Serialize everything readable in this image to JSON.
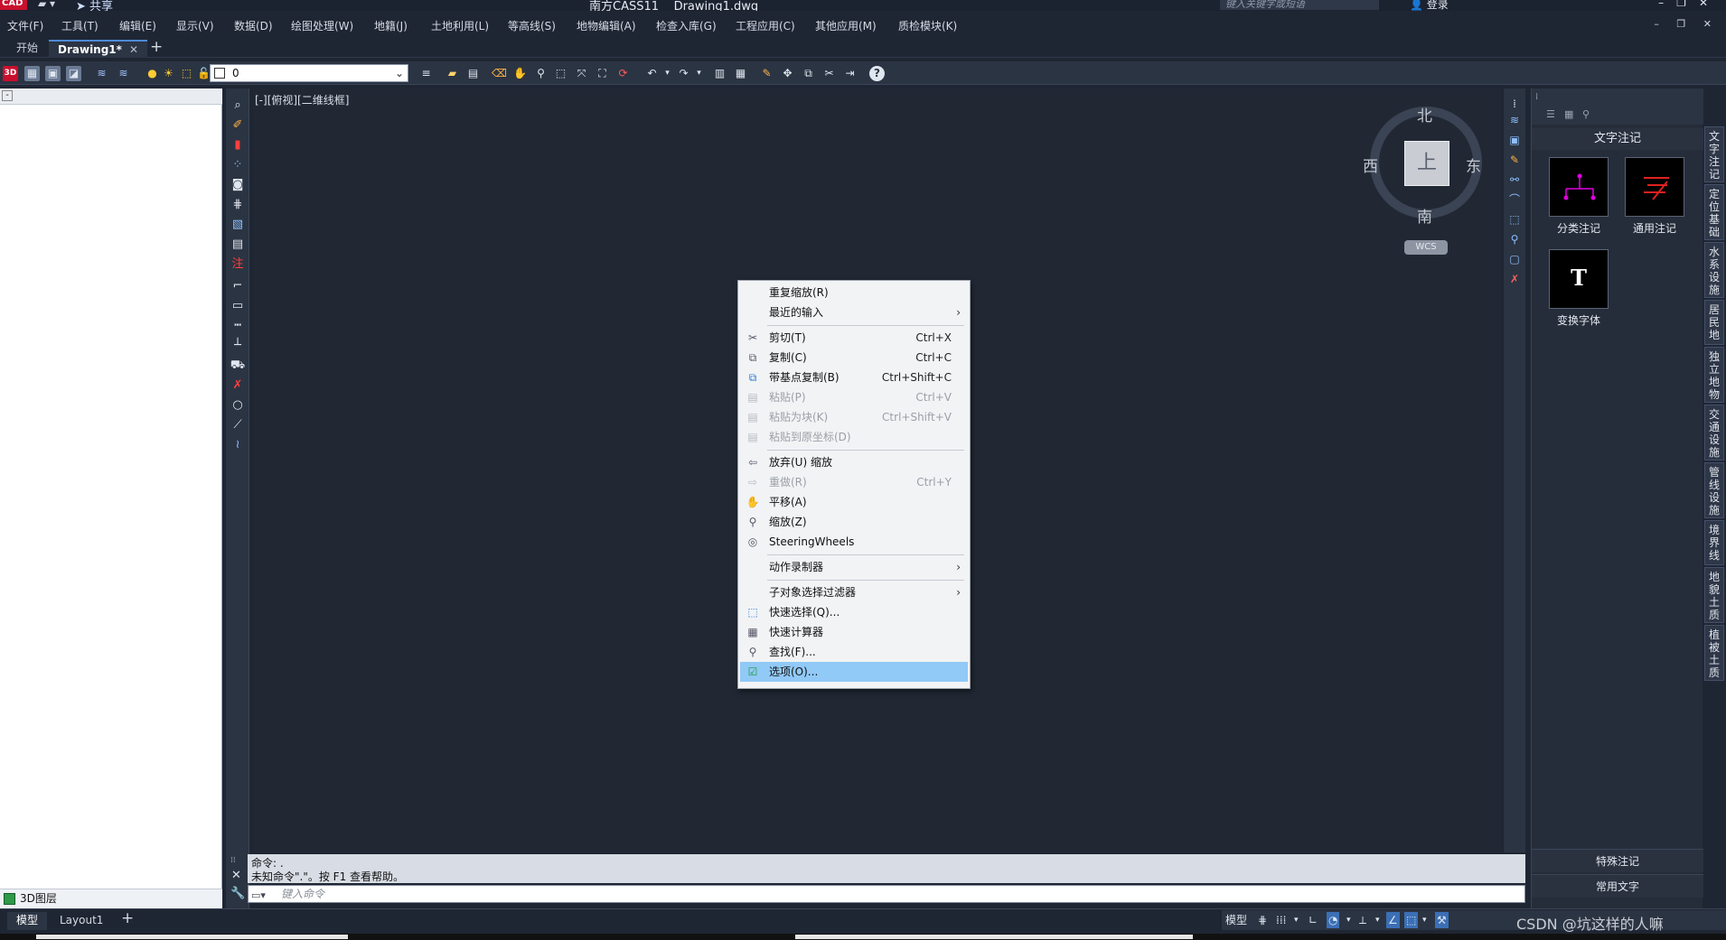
{
  "titlebar": {
    "logo": "CAD",
    "share_label": "共享",
    "app_title": "南方CASS11",
    "doc_title": "Drawing1.dwg",
    "search_placeholder": "键入关键字或短语",
    "login_label": "登录"
  },
  "menu": [
    "文件(F)",
    "工具(T)",
    "编辑(E)",
    "显示(V)",
    "数据(D)",
    "绘图处理(W)",
    "地籍(J)",
    "土地利用(L)",
    "等高线(S)",
    "地物编辑(A)",
    "检查入库(G)",
    "工程应用(C)",
    "其他应用(M)",
    "质检模块(K)"
  ],
  "tabs": {
    "start_label": "开始",
    "active_label": "Drawing1*",
    "close_glyph": "✕",
    "add_glyph": "+"
  },
  "toolbar": {
    "layer_value": "0",
    "help_glyph": "?"
  },
  "left_panel": {
    "minimize_glyph": "-",
    "layer_label": "3D图层"
  },
  "canvas": {
    "view_label": "[-][俯视][二维线框]"
  },
  "viewcube": {
    "north": "北",
    "south": "南",
    "east": "东",
    "west": "西",
    "face": "上",
    "wcs_label": "WCS"
  },
  "context_menu": {
    "items": [
      {
        "label": "重复缩放(R)",
        "shortcut": "",
        "submenu": false,
        "disabled": false,
        "icon": ""
      },
      {
        "label": "最近的输入",
        "shortcut": "",
        "submenu": true,
        "disabled": false,
        "icon": ""
      },
      {
        "label": "剪切(T)",
        "shortcut": "Ctrl+X",
        "submenu": false,
        "disabled": false,
        "icon": "cut-icon"
      },
      {
        "label": "复制(C)",
        "shortcut": "Ctrl+C",
        "submenu": false,
        "disabled": false,
        "icon": "copy-icon"
      },
      {
        "label": "带基点复制(B)",
        "shortcut": "Ctrl+Shift+C",
        "submenu": false,
        "disabled": false,
        "icon": "copy-base-icon"
      },
      {
        "label": "粘贴(P)",
        "shortcut": "Ctrl+V",
        "submenu": false,
        "disabled": true,
        "icon": "paste-icon"
      },
      {
        "label": "粘贴为块(K)",
        "shortcut": "Ctrl+Shift+V",
        "submenu": false,
        "disabled": true,
        "icon": "paste-block-icon"
      },
      {
        "label": "粘贴到原坐标(D)",
        "shortcut": "",
        "submenu": false,
        "disabled": true,
        "icon": "paste-orig-icon"
      },
      {
        "label": "放弃(U) 缩放",
        "shortcut": "",
        "submenu": false,
        "disabled": false,
        "icon": "undo-icon"
      },
      {
        "label": "重做(R)",
        "shortcut": "Ctrl+Y",
        "submenu": false,
        "disabled": true,
        "icon": "redo-icon"
      },
      {
        "label": "平移(A)",
        "shortcut": "",
        "submenu": false,
        "disabled": false,
        "icon": "pan-icon"
      },
      {
        "label": "缩放(Z)",
        "shortcut": "",
        "submenu": false,
        "disabled": false,
        "icon": "zoom-icon"
      },
      {
        "label": "SteeringWheels",
        "shortcut": "",
        "submenu": false,
        "disabled": false,
        "icon": "wheel-icon"
      },
      {
        "label": "动作录制器",
        "shortcut": "",
        "submenu": true,
        "disabled": false,
        "icon": ""
      },
      {
        "label": "子对象选择过滤器",
        "shortcut": "",
        "submenu": true,
        "disabled": false,
        "icon": ""
      },
      {
        "label": "快速选择(Q)...",
        "shortcut": "",
        "submenu": false,
        "disabled": false,
        "icon": "quickselect-icon"
      },
      {
        "label": "快速计算器",
        "shortcut": "",
        "submenu": false,
        "disabled": false,
        "icon": "calculator-icon"
      },
      {
        "label": "查找(F)...",
        "shortcut": "",
        "submenu": false,
        "disabled": false,
        "icon": "find-icon"
      },
      {
        "label": "选项(O)...",
        "shortcut": "",
        "submenu": false,
        "disabled": false,
        "icon": "options-check-icon",
        "highlighted": true
      }
    ],
    "submenu_glyph": "›"
  },
  "palette": {
    "title": "文字注记",
    "items": [
      {
        "label": "分类注记",
        "icon": "classify-note-icon"
      },
      {
        "label": "通用注记",
        "icon": "general-note-icon"
      },
      {
        "label": "变换字体",
        "icon": "font-change-icon",
        "glyph": "T"
      }
    ],
    "footer1": "特殊注记",
    "footer2": "常用文字"
  },
  "vertical_tabs": [
    "文字注记",
    "定位基础",
    "水系设施",
    "居民地",
    "独立地物",
    "交通设施",
    "管线设施",
    "境界线",
    "地貌土质",
    "植被土质"
  ],
  "command": {
    "line1": "命令: .",
    "line2": "未知命令\".\"。按 F1 查看帮助。",
    "input_placeholder": "键入命令",
    "close_glyph": "✕"
  },
  "layout_tabs": [
    "模型",
    "Layout1"
  ],
  "status": {
    "model_label": "模型"
  },
  "watermark": "CSDN @坑这样的人嘛",
  "colors": {
    "bg": "#1f2633",
    "canvas": "#212834",
    "highlight": "#91c9f7",
    "accent": "#3b6fb6",
    "magenta": "#e000e0",
    "red": "#e02020"
  }
}
